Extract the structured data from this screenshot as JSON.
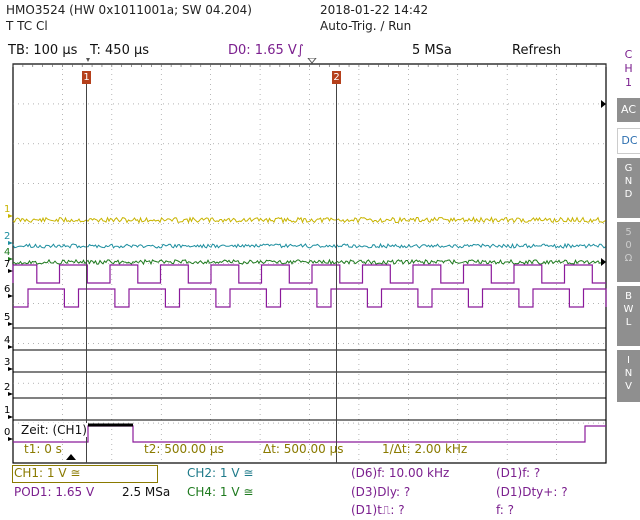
{
  "header": {
    "model": "HMO3524 (HW 0x1011001a; SW 04.204)",
    "mode": "T TC Cl",
    "datetime": "2018-01-22 14:42",
    "trigger_status": "Auto-Trig. / Run"
  },
  "topbar": {
    "tb": "TB: 100 µs",
    "t": "T: 450 µs",
    "d0": "D0: 1.65 V",
    "trigger_edge_glyph": "∫",
    "sample_rate": "5 MSa",
    "refresh": "Refresh"
  },
  "side": {
    "ch_label": [
      "C",
      "H",
      "1"
    ],
    "ac": "AC",
    "dc": "DC",
    "gnd": [
      "G",
      "N",
      "D"
    ],
    "fifty": [
      "5",
      "0",
      "Ω"
    ],
    "bwl": [
      "B",
      "W",
      "L"
    ],
    "inv": [
      "I",
      "N",
      "V"
    ]
  },
  "colors": {
    "grid": "#000000",
    "ch1": "#c8b400",
    "ch2": "#1e8fa0",
    "ch4": "#1e7a1e",
    "digital": "#8b1a9b",
    "cursor": "#444444",
    "marker": "#b5401c",
    "sidebar_gray": "#8f8f8f"
  },
  "display": {
    "channel_labels": [
      "1",
      "2",
      "4",
      "7",
      "6",
      "5",
      "4",
      "3",
      "2",
      "1",
      "0"
    ],
    "cursor_marker_1": "1",
    "cursor_marker_2": "2",
    "zeit": "Zeit: (CH1)",
    "t1": "t1: 0 s",
    "t2": "t2: 500.00 µs",
    "dt": "Δt: 500.00 µs",
    "inv_dt": "1/Δt: 2.00 kHz"
  },
  "footer": {
    "ch1": "CH1: 1 V ≅",
    "ch2": "CH2: 1 V ≅",
    "pod1": "POD1: 1.65 V",
    "pod_rate": "2.5 MSa",
    "ch4": "CH4: 1 V ≅",
    "d6_f": "(D6)f: 10.00 kHz",
    "d3_dly": "(D3)Dly: ?",
    "d1_t": "(D1)t⎍: ?",
    "d1_f": "(D1)f: ?",
    "d1_dty": "(D1)Dty+: ?",
    "f": "f: ?"
  }
}
